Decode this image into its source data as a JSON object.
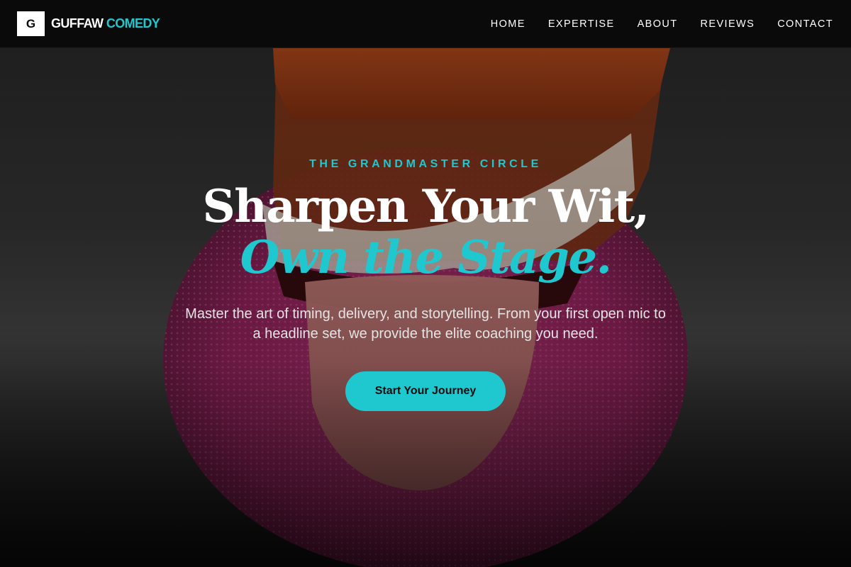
{
  "brand": {
    "mark": "G",
    "name_primary": "GUFFAW",
    "name_accent": "COMEDY",
    "accent_color": "#1fc8cf"
  },
  "nav": {
    "items": [
      {
        "label": "HOME"
      },
      {
        "label": "EXPERTISE"
      },
      {
        "label": "ABOUT"
      },
      {
        "label": "REVIEWS"
      },
      {
        "label": "CONTACT"
      }
    ]
  },
  "hero": {
    "eyebrow": "THE GRANDMASTER CIRCLE",
    "headline_line1": "Sharpen Your Wit,",
    "headline_line2": "Own the Stage.",
    "description": "Master the art of timing, delivery, and storytelling. From your first open mic to a headline set, we provide the elite coaching you need.",
    "cta_label": "Start Your Journey",
    "background_image": "wind-up-chattering-teeth-photo"
  }
}
